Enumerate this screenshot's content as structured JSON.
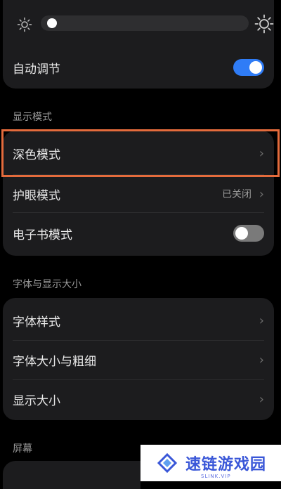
{
  "brightness": {
    "level": 0.02,
    "auto_label": "自动调节",
    "auto_on": true
  },
  "display_mode": {
    "section_title": "显示模式",
    "dark_mode_label": "深色模式",
    "eye_care_label": "护眼模式",
    "eye_care_value": "已关闭",
    "ebook_label": "电子书模式",
    "ebook_on": false
  },
  "font": {
    "section_title": "字体与显示大小",
    "style_label": "字体样式",
    "size_weight_label": "字体大小与粗细",
    "display_size_label": "显示大小"
  },
  "screen": {
    "section_title": "屏幕"
  },
  "watermark": {
    "name": "速链游戏园",
    "url": "SLINK.VIP"
  },
  "colors": {
    "accent": "#2f7cf6",
    "highlight": "#e46b3c",
    "card": "#1c1c1e"
  }
}
